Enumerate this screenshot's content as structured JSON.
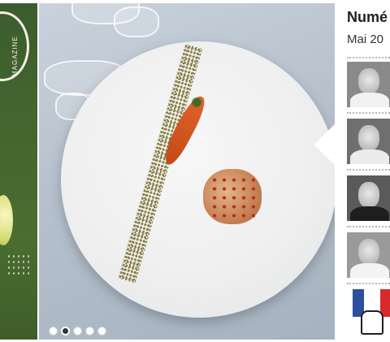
{
  "cover": {
    "wordmark": "MAGAZINE",
    "colors": {
      "background": "#45672f",
      "text": "#f4f1e6"
    }
  },
  "hero": {
    "image": "plated-dish-photo",
    "slides": {
      "count": 5,
      "active_index": 2
    }
  },
  "side_panel": {
    "title": "Numé",
    "subtitle": "Mai 20",
    "chefs": [
      {
        "icon": "chef-portrait-1"
      },
      {
        "icon": "chef-portrait-2"
      },
      {
        "icon": "chef-portrait-3"
      },
      {
        "icon": "chef-portrait-4"
      }
    ],
    "emblem": {
      "icon": "tricolor-chef-hat-emblem",
      "colors": [
        "#2d4f9e",
        "#ffffff",
        "#d72b2b"
      ]
    }
  },
  "accent": "#2f3740"
}
